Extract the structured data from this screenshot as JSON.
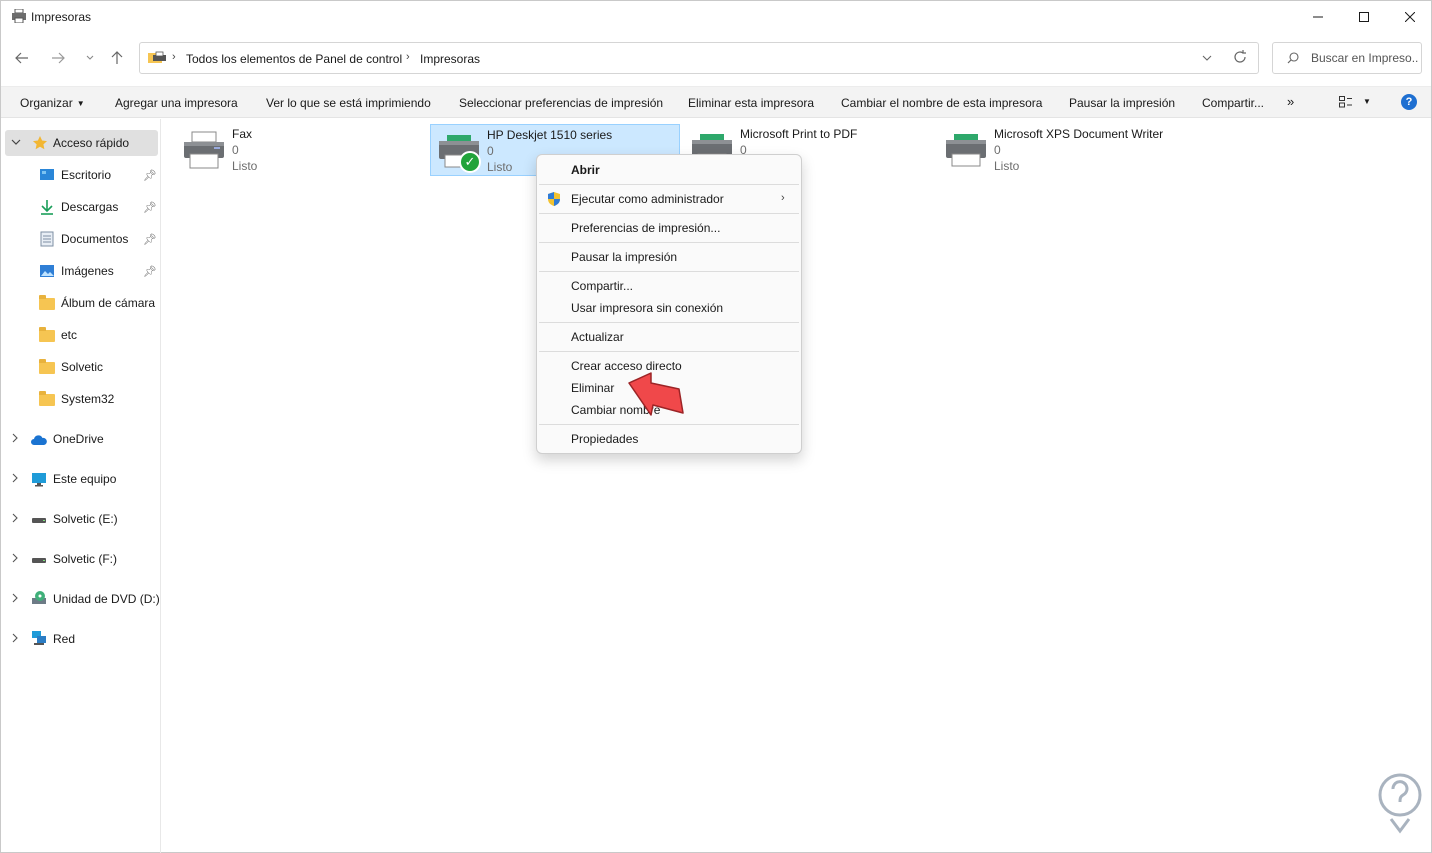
{
  "window": {
    "title": "Impresoras"
  },
  "address": {
    "crumbs": [
      "Todos los elementos de Panel de control",
      "Impresoras"
    ]
  },
  "search": {
    "placeholder": "Buscar en Impreso..."
  },
  "commandbar": {
    "organize": "Organizar",
    "items": [
      "Agregar una impresora",
      "Ver lo que se está imprimiendo",
      "Seleccionar preferencias de impresión",
      "Eliminar esta impresora",
      "Cambiar el nombre de esta impresora",
      "Pausar la impresión",
      "Compartir..."
    ],
    "more": "»",
    "help": "?"
  },
  "sidebar": {
    "quick_access": "Acceso rápido",
    "quick_items": [
      {
        "label": "Escritorio",
        "icon": "desktop-icon",
        "pinned": true
      },
      {
        "label": "Descargas",
        "icon": "download-icon",
        "pinned": true
      },
      {
        "label": "Documentos",
        "icon": "document-icon",
        "pinned": true
      },
      {
        "label": "Imágenes",
        "icon": "pictures-icon",
        "pinned": true
      },
      {
        "label": "Álbum de cámara",
        "icon": "folder-icon",
        "pinned": false
      },
      {
        "label": "etc",
        "icon": "folder-icon",
        "pinned": false
      },
      {
        "label": "Solvetic",
        "icon": "folder-icon",
        "pinned": false
      },
      {
        "label": "System32",
        "icon": "folder-icon",
        "pinned": false
      }
    ],
    "roots": [
      {
        "label": "OneDrive",
        "icon": "onedrive-icon"
      },
      {
        "label": "Este equipo",
        "icon": "computer-icon"
      },
      {
        "label": "Solvetic (E:)",
        "icon": "drive-icon"
      },
      {
        "label": "Solvetic (F:)",
        "icon": "drive-icon"
      },
      {
        "label": "Unidad de DVD (D:)",
        "icon": "dvd-icon"
      },
      {
        "label": "Red",
        "icon": "network-icon"
      }
    ]
  },
  "printers": [
    {
      "name": "Fax",
      "count": "0",
      "status": "Listo",
      "selected": false,
      "default": false
    },
    {
      "name": "HP Deskjet 1510 series",
      "count": "0",
      "status": "Listo",
      "selected": true,
      "default": true
    },
    {
      "name": "Microsoft Print to PDF",
      "count": "0",
      "status": "",
      "selected": false,
      "default": false
    },
    {
      "name": "Microsoft XPS Document Writer",
      "count": "0",
      "status": "Listo",
      "selected": false,
      "default": false
    }
  ],
  "context_menu": {
    "open": "Abrir",
    "run_as_admin": "Ejecutar como administrador",
    "print_prefs": "Preferencias de impresión...",
    "pause": "Pausar la impresión",
    "share": "Compartir...",
    "offline": "Usar impresora sin conexión",
    "refresh": "Actualizar",
    "shortcut": "Crear acceso directo",
    "delete": "Eliminar",
    "rename": "Cambiar nombre",
    "properties": "Propiedades"
  },
  "colors": {
    "selection": "#cce8ff",
    "accent": "#1e6fd1",
    "arrow": "#f0484a",
    "check": "#21a33a"
  }
}
